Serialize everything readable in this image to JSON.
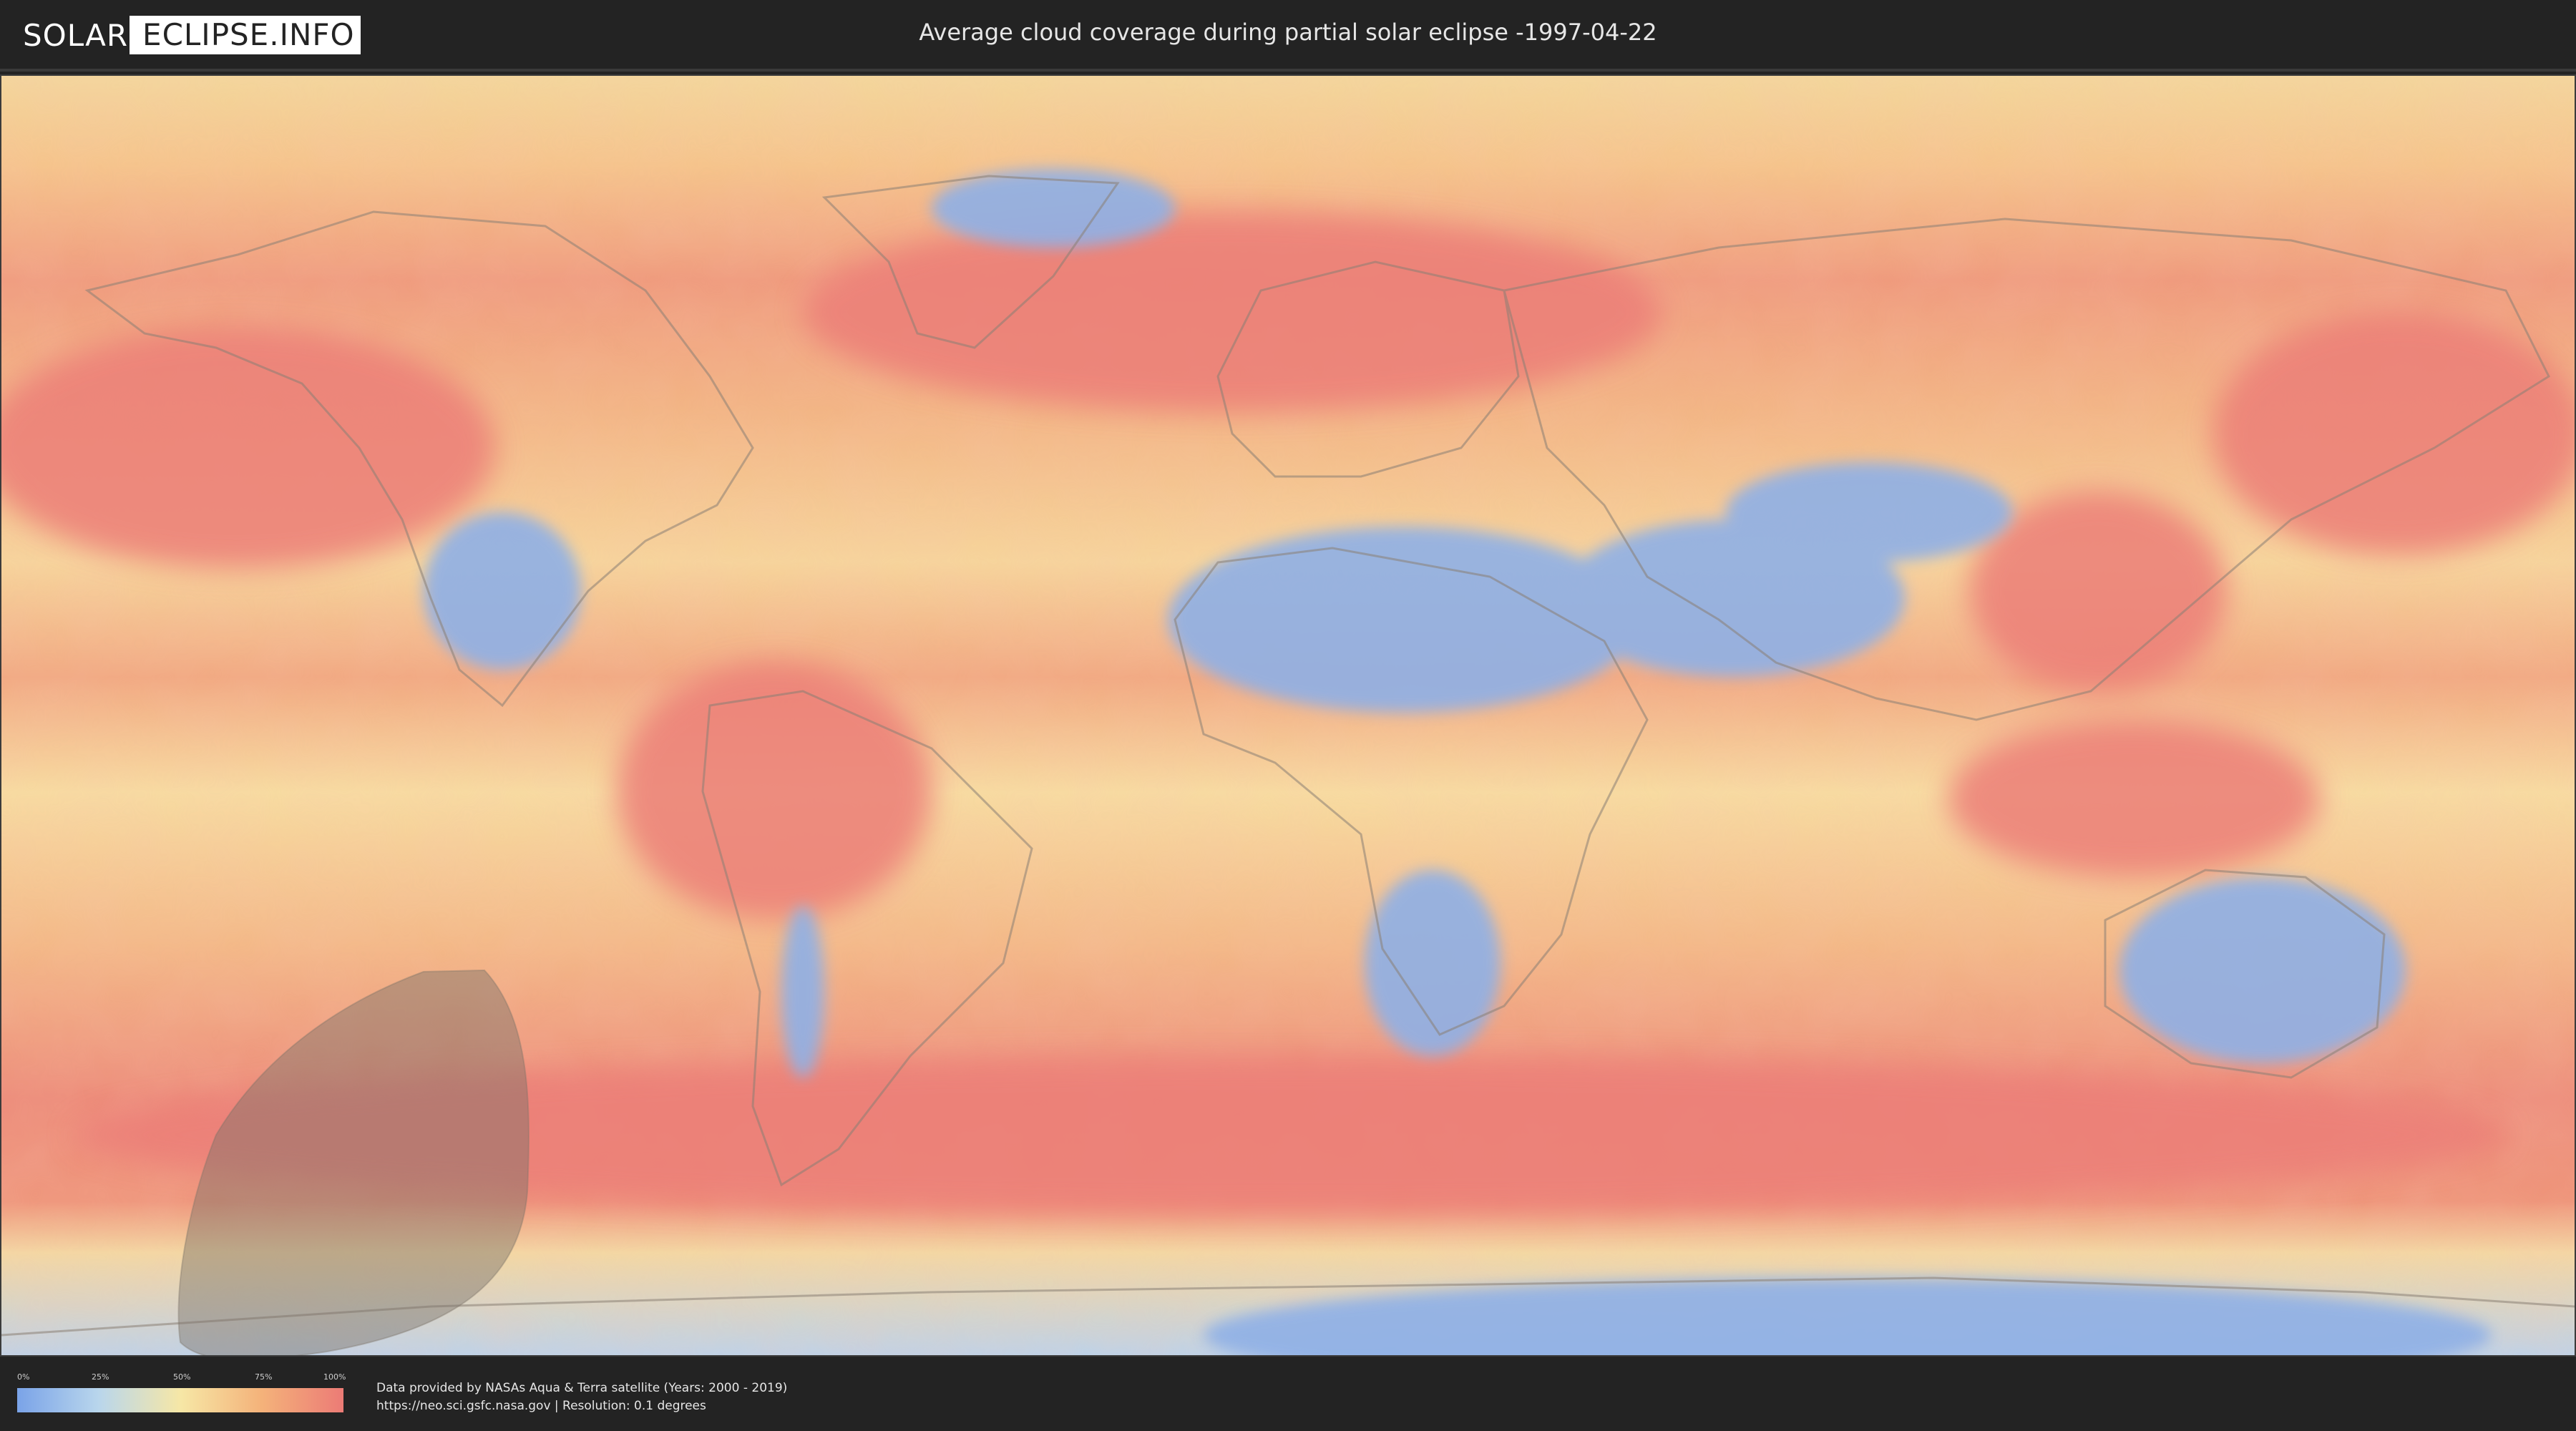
{
  "header": {
    "logo_part1": "SOLAR",
    "logo_part2": "ECLIPSE.INFO",
    "title": "Average cloud coverage during partial solar eclipse -1997-04-22"
  },
  "legend": {
    "ticks": [
      "0%",
      "25%",
      "50%",
      "75%",
      "100%"
    ],
    "colors": [
      "#7aa3e8",
      "#b9d6ec",
      "#f6e7a6",
      "#f4b27a",
      "#ec7b76"
    ]
  },
  "footer": {
    "credit_line1": "Data provided by NASAs Aqua & Terra satellite (Years: 2000 - 2019)",
    "credit_line2": "https://neo.sci.gsfc.nasa.gov | Resolution: 0.1 degrees"
  },
  "map": {
    "projection": "equirectangular world map",
    "overlay": "eclipse visibility area (shaded)",
    "overlay_color": "#7a7268"
  }
}
